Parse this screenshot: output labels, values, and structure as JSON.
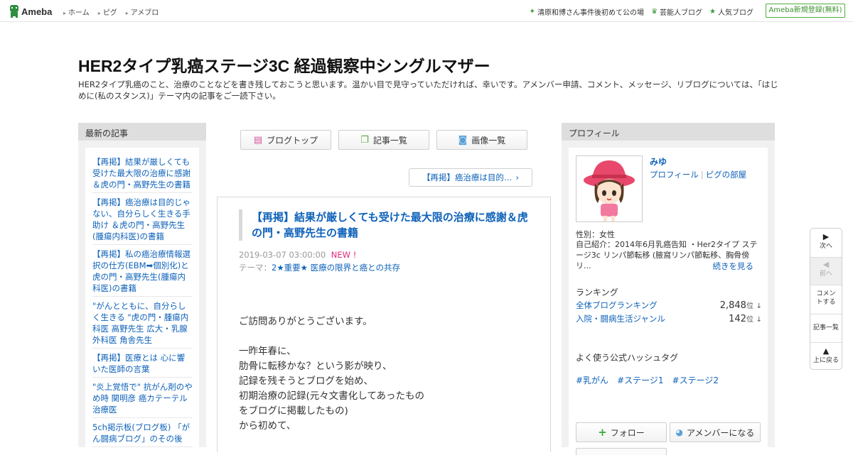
{
  "topbar": {
    "logo_text": "Ameba",
    "nav": [
      "ホーム",
      "ピグ",
      "アメブロ"
    ],
    "links": [
      {
        "icon": "sparkle-icon",
        "label": "清原和博さん事件後初めて公の場"
      },
      {
        "icon": "crown-icon",
        "label": "芸能人ブログ"
      },
      {
        "icon": "star-icon",
        "label": "人気ブログ"
      }
    ],
    "signup_label": "Ameba新規登録(無料)",
    "accent_color": "#4fae3d"
  },
  "blog": {
    "title": "HER2タイプ乳癌ステージ3C 経過観察中シングルマザー",
    "description": "HER2タイプ乳癌のこと、治療のことなどを書き残しておこうと思います。温かい目で見守っていただければ、幸いです。アメンバー申請、コメント、メッセージ、リブログについては、「はじめに(私のスタンス)」テーマ内の記事をご一読下さい。"
  },
  "left": {
    "heading": "最新の記事",
    "items": [
      "【再掲】結果が厳しくても受けた最大限の治療に感謝 ＆虎の門・高野先生の書籍",
      "【再掲】癌治療は目的じゃない、自分らしく生きる手助け ＆虎の門・高野先生(腫瘍内科医)の書籍",
      "【再掲】私の癌治療情報選択の仕方(EBM➡個別化)と虎の門・高野先生(腫瘍内科医)の書籍",
      "\"がんとともに、自分らしく生きる \"虎の門・腫瘍内科医 高野先生 広大・乳腺外科医 角舎先生",
      "【再掲】医療とは 心に響いた医師の言葉",
      "\"炎上覚悟で\" 抗がん剤のやめ時 関明彦 癌カテーテル治療医",
      "5ch掲示板(ブログ板) 「がん闘病ブログ」のその後"
    ]
  },
  "center": {
    "buttons": [
      {
        "icon": "document-icon",
        "label": "ブログトップ"
      },
      {
        "icon": "list-icon",
        "label": "記事一覧"
      },
      {
        "icon": "camera-icon",
        "label": "画像一覧"
      }
    ],
    "prev_article": "【再掲】癌治療は目的…",
    "article": {
      "title": "【再掲】結果が厳しくても受けた最大限の治療に感謝＆虎の門・高野先生の書籍",
      "date": "2019-03-07 03:00:00",
      "new_badge": "NEW !",
      "theme_label": "テーマ：",
      "theme": "2★重要★ 医療の限界と癌との共存",
      "body": [
        "ご訪問ありがとうございます。",
        "",
        "一昨年春に、",
        "肋骨に転移かな？という影が映り、",
        "記録を残そうとブログを始め、",
        "初期治療の記録(元々文書化してあったもの",
        "をブログに掲載したもの)",
        "から初めて、"
      ]
    }
  },
  "right": {
    "heading": "プロフィール",
    "name": "みゆ",
    "link_profile": "プロフィール",
    "link_pig": "ピグの部屋",
    "sex": "性別：女性",
    "intro": "自己紹介：2014年6月乳癌告知 ・Her2タイプ ステージ3c リンパ節転移 (腋窩リンパ節転移、胸骨傍リ...",
    "more": "続きを見る",
    "ranking_heading": "ランキング",
    "rankings": [
      {
        "label": "全体ブログランキング",
        "value": "2,848",
        "unit": "位",
        "trend": "↓"
      },
      {
        "label": "入院・闘病生活ジャンル",
        "value": "142",
        "unit": "位",
        "trend": "↓"
      }
    ],
    "hashtag_heading": "よく使う公式ハッシュタグ",
    "hashtags": [
      "#乳がん",
      "#ステージ1",
      "#ステージ2"
    ],
    "follow_label": "フォロー",
    "amember_label": "アメンバーになる"
  },
  "sidenav": {
    "next": "次へ",
    "prev": "前へ",
    "comment": "コメントする",
    "list": "記事一覧",
    "top": "上に戻る"
  }
}
